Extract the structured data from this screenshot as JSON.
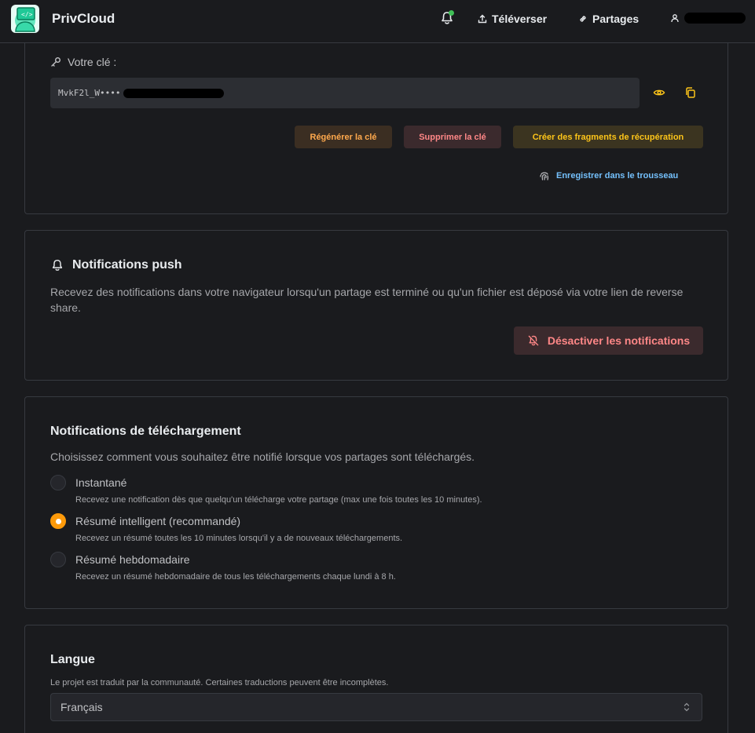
{
  "header": {
    "brand": "PrivCloud",
    "nav": {
      "upload_label": "Téléverser",
      "shares_label": "Partages"
    },
    "status_dot_color": "#40c057"
  },
  "key_card": {
    "label": "Votre clé :",
    "value_prefix": "MvkF2l_W••••",
    "regenerate_label": "Régénérer la clé",
    "delete_label": "Supprimer la clé",
    "fragments_label": "Créer des fragments de récupération",
    "keyring_label": "Enregistrer dans le trousseau"
  },
  "push_card": {
    "title": "Notifications push",
    "description": "Recevez des notifications dans votre navigateur lorsqu'un partage est terminé ou qu'un fichier est déposé via votre lien de reverse share.",
    "disable_label": "Désactiver les notifications"
  },
  "download_card": {
    "title": "Notifications de téléchargement",
    "description": "Choisissez comment vous souhaitez être notifié lorsque vos partages sont téléchargés.",
    "options": [
      {
        "label": "Instantané",
        "description": "Recevez une notification dès que quelqu'un télécharge votre partage (max une fois toutes les 10 minutes).",
        "checked": false
      },
      {
        "label": "Résumé intelligent (recommandé)",
        "description": "Recevez un résumé toutes les 10 minutes lorsqu'il y a de nouveaux téléchargements.",
        "checked": true
      },
      {
        "label": "Résumé hebdomadaire",
        "description": "Recevez un résumé hebdomadaire de tous les téléchargements chaque lundi à 8 h.",
        "checked": false
      }
    ]
  },
  "language_card": {
    "title": "Langue",
    "description": "Le projet est traduit par la communauté. Certaines traductions peuvent être incomplètes.",
    "selected": "Français"
  },
  "colors": {
    "accent": "#fd9a0a",
    "danger": "#ff8787",
    "link": "#74c0fc"
  }
}
